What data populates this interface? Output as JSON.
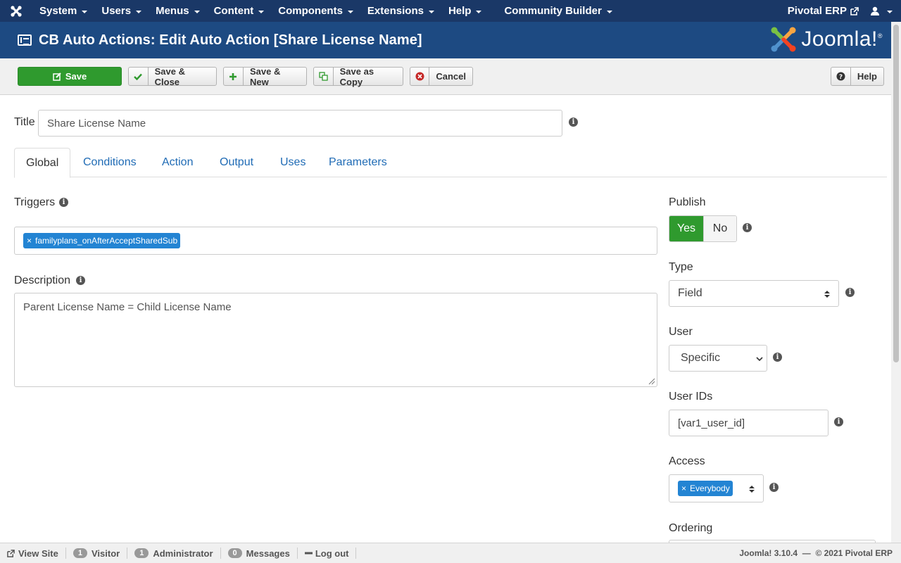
{
  "topnav": {
    "menu": [
      "System",
      "Users",
      "Menus",
      "Content",
      "Components",
      "Extensions",
      "Help",
      "Community Builder"
    ],
    "site_name": "Pivotal ERP",
    "icons": {
      "logo": "joomla-icon",
      "external": "external-link-icon",
      "user": "user-icon"
    }
  },
  "titlebar": {
    "title": "CB Auto Actions: Edit Auto Action [Share License Name]",
    "brand": "Joomla!",
    "brand_reg": "®"
  },
  "toolbar": {
    "save": "Save",
    "save_close": "Save & Close",
    "save_new": "Save & New",
    "save_copy": "Save as Copy",
    "cancel": "Cancel",
    "help": "Help"
  },
  "form": {
    "title_label": "Title",
    "title_value": "Share License Name",
    "tabs": [
      "Global",
      "Conditions",
      "Action",
      "Output",
      "Uses",
      "Parameters"
    ],
    "active_tab": "Global",
    "triggers_label": "Triggers",
    "triggers": [
      "familyplans_onAfterAcceptSharedSub"
    ],
    "description_label": "Description",
    "description_value": "Parent License Name = Child License Name",
    "publish_label": "Publish",
    "publish_yes": "Yes",
    "publish_no": "No",
    "type_label": "Type",
    "type_value": "Field",
    "user_label": "User",
    "user_value": "Specific",
    "user_ids_label": "User IDs",
    "user_ids_value": "[var1_user_id]",
    "access_label": "Access",
    "access_tags": [
      "Everybody"
    ],
    "ordering_label": "Ordering"
  },
  "statusbar": {
    "view_site": "View Site",
    "visitor_count": "1",
    "visitor": "Visitor",
    "admin_count": "1",
    "admin": "Administrator",
    "messages_count": "0",
    "messages": "Messages",
    "logout": "Log out",
    "version": "Joomla! 3.10.4",
    "copyright": "© 2021 Pivotal ERP"
  },
  "colors": {
    "topnav_bg": "#1a3867",
    "titlebar_bg": "#1d4a82",
    "save_green": "#2f9a2e",
    "tag_blue": "#2384d3",
    "link_blue": "#1f6bb5"
  }
}
